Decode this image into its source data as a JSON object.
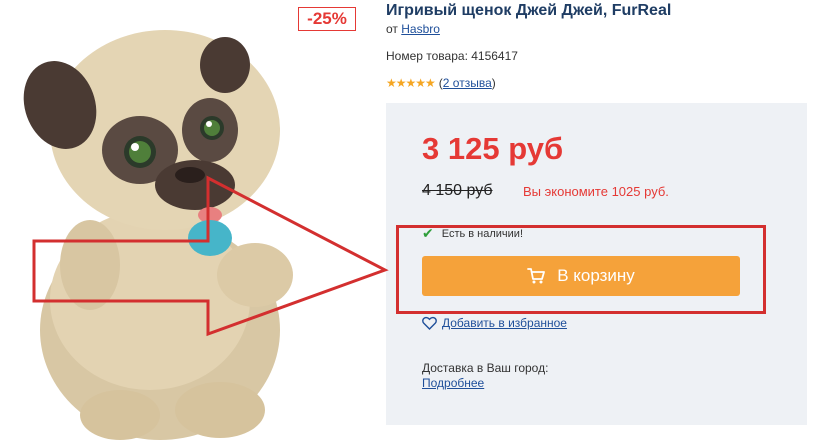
{
  "product": {
    "title": "Игривый щенок Джей Джей, FurReal",
    "brand_prefix": "от",
    "brand": "Hasbro",
    "sku_label": "Номер товара: 4156417",
    "rating_stars": "★★★★★",
    "review_open": "(",
    "review_link": "2 отзыва",
    "review_close": ")",
    "discount": "-25%",
    "image_icon": "plush-pug-toy"
  },
  "price": {
    "current": "3 125 руб",
    "old": "4 150 руб",
    "savings": "Вы экономите 1025 руб."
  },
  "stock": {
    "status": "Есть в наличии!"
  },
  "cart": {
    "label": "В корзину",
    "icon": "cart-icon"
  },
  "favorite": {
    "label": "Добавить в избранное",
    "icon": "heart-icon"
  },
  "delivery": {
    "label": "Доставка в Ваш город:",
    "link": "Подробнее"
  },
  "colors": {
    "accent_red": "#e53935",
    "button_orange": "#f5a23a",
    "link_blue": "#1f4f9a",
    "star_gold": "#f5a623",
    "stock_green": "#2e9e3a",
    "panel_bg": "#eef1f5",
    "annotation_red": "#d32f2f"
  }
}
